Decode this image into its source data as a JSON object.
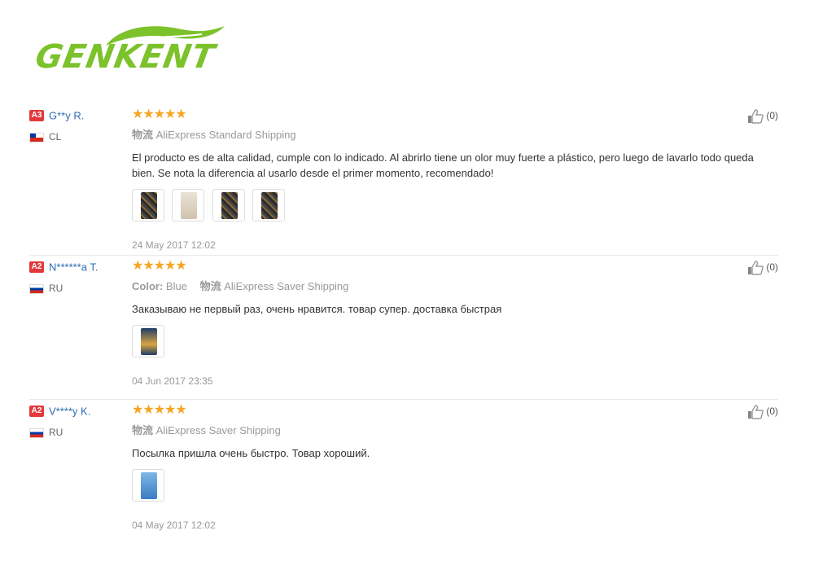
{
  "brand": {
    "name": "GENKENT",
    "color": "#7cc22b"
  },
  "colors": {
    "star": "#f5a623",
    "username": "#2c6bb4",
    "level_badge": "#e4393c"
  },
  "reviews": [
    {
      "level": "A3",
      "username": "G**y R.",
      "country": "CL",
      "rating": 5,
      "stars": "★★★★★",
      "color_label": "",
      "color_value": "",
      "shipping_prefix": "物流",
      "shipping": "AliExpress Standard Shipping",
      "text": "El producto es de alta calidad, cumple con lo indicado. Al abrirlo tiene un olor muy fuerte a plástico, pero luego de lavarlo todo queda bien. Se nota la diferencia al usarlo desde el primer momento, recomendado!",
      "photo_count": 4,
      "date": "24 May 2017 12:02",
      "likes": "(0)"
    },
    {
      "level": "A2",
      "username": "N******a T.",
      "country": "RU",
      "rating": 5,
      "stars": "★★★★★",
      "color_label": "Color:",
      "color_value": "Blue",
      "shipping_prefix": "物流",
      "shipping": "AliExpress Saver Shipping",
      "text": "Заказываю не первый раз, очень нравится. товар супер. доставка быстрая",
      "photo_count": 1,
      "date": "04 Jun 2017 23:35",
      "likes": "(0)"
    },
    {
      "level": "A2",
      "username": "V****y K.",
      "country": "RU",
      "rating": 5,
      "stars": "★★★★★",
      "color_label": "",
      "color_value": "",
      "shipping_prefix": "物流",
      "shipping": "AliExpress Saver Shipping",
      "text": "Посылка пришла очень быстро. Товар хороший.",
      "photo_count": 1,
      "date": "04 May 2017 12:02",
      "likes": "(0)"
    }
  ]
}
